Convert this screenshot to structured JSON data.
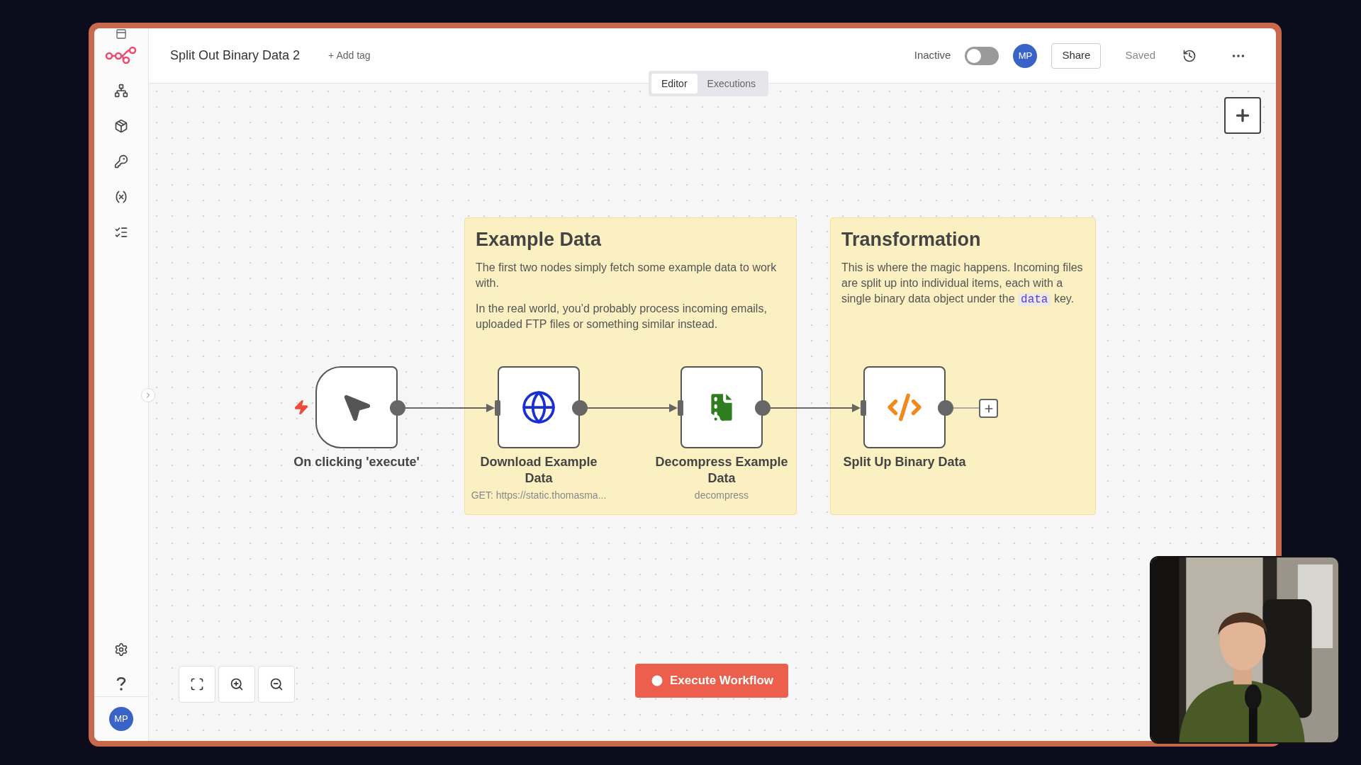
{
  "header": {
    "title": "Split Out Binary Data 2",
    "add_tag": "+ Add tag",
    "status_label": "Inactive",
    "active": false,
    "avatar_initials": "MP",
    "share": "Share",
    "save_state": "Saved"
  },
  "tabs": [
    {
      "label": "Editor",
      "selected": true
    },
    {
      "label": "Executions",
      "selected": false
    }
  ],
  "sidebar": {
    "avatar_initials": "MP"
  },
  "notes": [
    {
      "title": "Example Data",
      "paragraphs": [
        [
          {
            "kind": "text",
            "text": "The first two nodes simply fetch some example data to work with."
          }
        ],
        [
          {
            "kind": "text",
            "text": "In the real world, you’d probably process incoming emails, uploaded FTP files or something similar instead."
          }
        ]
      ]
    },
    {
      "title": "Transformation",
      "paragraphs": [
        [
          {
            "kind": "text",
            "text": "This is where the magic happens. Incoming files are split up into individual items, each with a single binary data object under the "
          },
          {
            "kind": "code",
            "text": "data"
          },
          {
            "kind": "text",
            "text": " key."
          }
        ]
      ]
    }
  ],
  "nodes": [
    {
      "name": "On clicking 'execute'",
      "kind": "trigger"
    },
    {
      "name": "Download Example Data",
      "subtitle": "GET: https://static.thomasma...",
      "kind": "http"
    },
    {
      "name": "Decompress Example Data",
      "subtitle": "decompress",
      "kind": "compression"
    },
    {
      "name": "Split Up Binary Data",
      "kind": "code"
    }
  ],
  "execute_button": "Execute Workflow"
}
